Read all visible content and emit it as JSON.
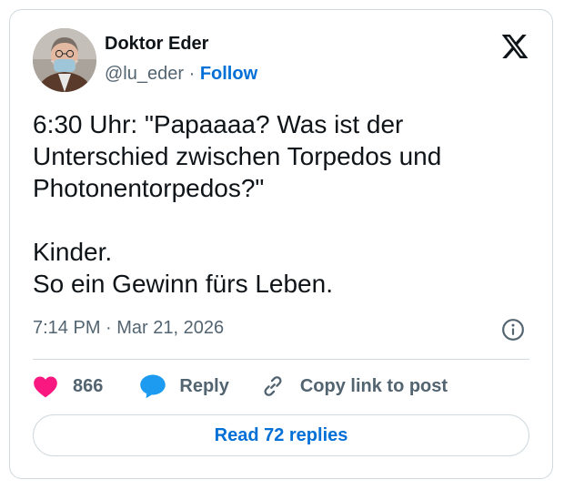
{
  "author": {
    "name": "Doktor Eder",
    "handle": "@lu_eder",
    "separator": " · ",
    "follow_label": "Follow"
  },
  "tweet": {
    "lines": [
      "6:30 Uhr: \"Papaaaa? Was ist der",
      "Unterschied zwischen Torpedos und",
      "Photonentorpedos?\"",
      "",
      "Kinder.",
      "So ein Gewinn fürs Leben."
    ],
    "timestamp": "7:14 PM · Mar 21, 2026"
  },
  "actions": {
    "likes_count": "866",
    "reply_label": "Reply",
    "copy_label": "Copy link to post"
  },
  "read_replies_label": "Read 72 replies",
  "icons": {
    "brand": "x-logo-icon",
    "info": "info-icon",
    "like": "heart-icon",
    "reply": "speech-bubble-icon",
    "copy": "link-icon"
  },
  "colors": {
    "text": "#0f1419",
    "muted": "#536471",
    "link": "#006fd6",
    "heart": "#f91880",
    "reply_bubble": "#1d9bf0",
    "border": "#cfd9de"
  }
}
